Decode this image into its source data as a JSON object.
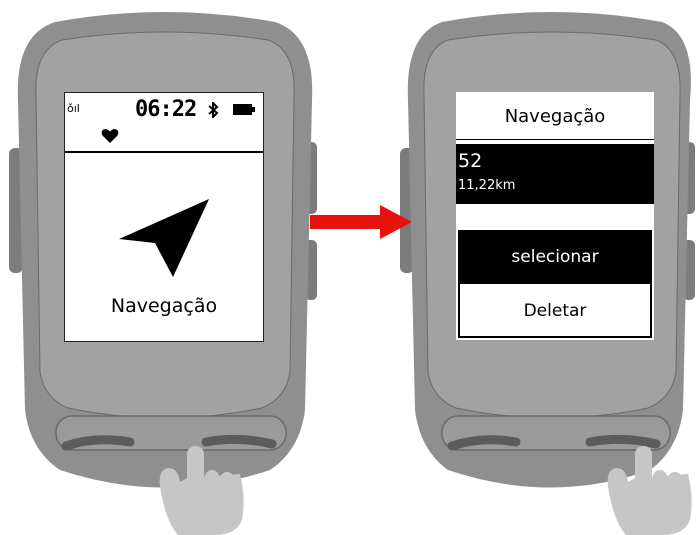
{
  "left_screen": {
    "status": {
      "signal_label": "ǒ",
      "signal_bars_label": "ıl",
      "time": "06:22",
      "bluetooth_icon": "bluetooth-icon",
      "battery_icon": "battery-icon",
      "heart_icon": "heart-icon"
    },
    "nav_icon": "navigation-arrow-icon",
    "label": "Navegação"
  },
  "right_screen": {
    "title": "Navegação",
    "route": {
      "name": "52",
      "distance": "11,22km"
    },
    "menu": [
      {
        "label": "selecionar",
        "selected": true
      },
      {
        "label": "Deletar",
        "selected": false
      }
    ]
  },
  "transition_arrow_color": "#e8120c",
  "device_color": "#8a8a8a",
  "hand_color": "#c8c8c8"
}
